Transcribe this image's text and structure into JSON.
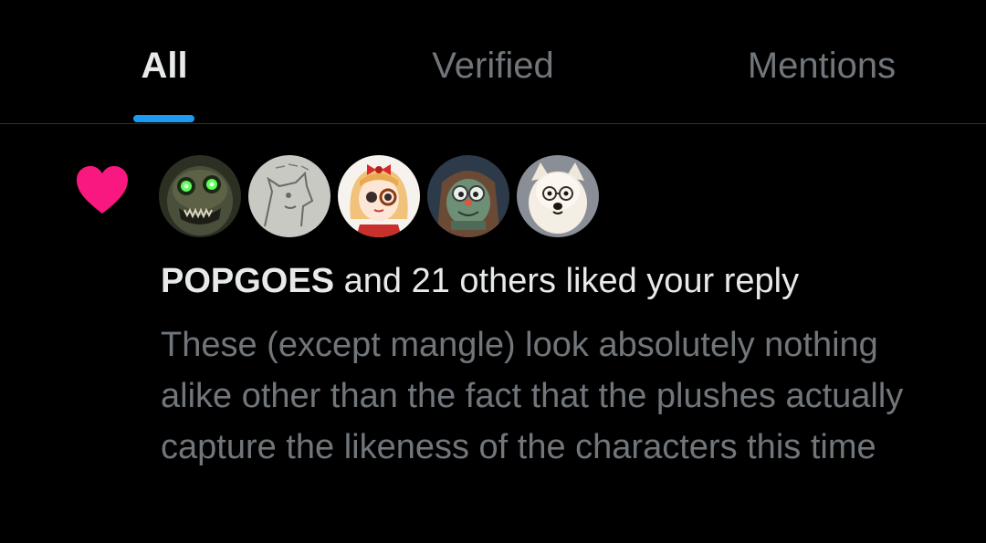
{
  "tabs": [
    {
      "label": "All",
      "active": true
    },
    {
      "label": "Verified",
      "active": false
    },
    {
      "label": "Mentions",
      "active": false
    }
  ],
  "colors": {
    "background": "#000000",
    "accent": "#1d9bf0",
    "heart": "#f91880",
    "text_primary": "#e7e9ea",
    "text_secondary": "#71767b"
  },
  "notification": {
    "icon": "heart-icon",
    "avatars": [
      {
        "icon": "animatronic-avatar"
      },
      {
        "icon": "sketch-avatar"
      },
      {
        "icon": "anime-girl-avatar"
      },
      {
        "icon": "green-creature-avatar"
      },
      {
        "icon": "samoyed-dog-avatar"
      }
    ],
    "user_name": "POPGOES",
    "action_text": " and 21 others liked your reply",
    "reply_text": "These (except mangle) look absolutely nothing alike other than the fact that the plushes actually capture the likeness of the characters this time"
  }
}
